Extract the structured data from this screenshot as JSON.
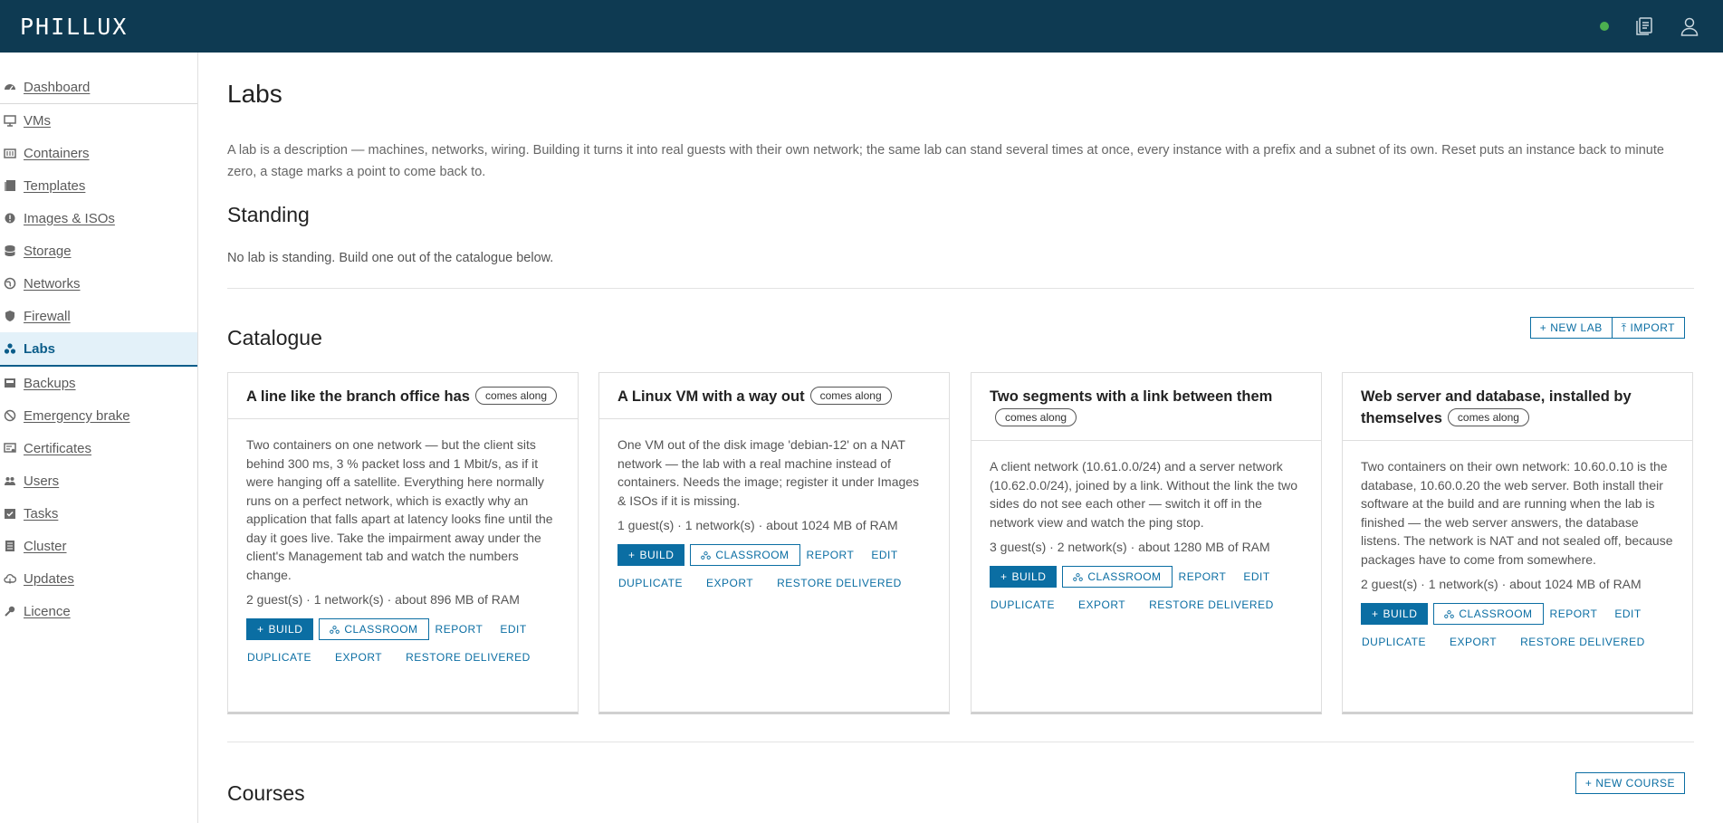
{
  "app": {
    "logo": "PHILLUX",
    "colors": {
      "topbar": "#0e3a52",
      "accent": "#0b6ea3",
      "status": "#4caf50",
      "active_bg": "#e3f1f9"
    }
  },
  "header": {
    "icons": [
      "status-dot",
      "clipboard-icon",
      "user-icon"
    ]
  },
  "sidebar": {
    "items": [
      {
        "label": "Dashboard",
        "icon": "dashboard-icon"
      },
      {
        "label": "VMs",
        "icon": "monitor-icon"
      },
      {
        "label": "Containers",
        "icon": "container-icon"
      },
      {
        "label": "Templates",
        "icon": "template-icon"
      },
      {
        "label": "Images & ISOs",
        "icon": "disc-icon"
      },
      {
        "label": "Storage",
        "icon": "database-icon"
      },
      {
        "label": "Networks",
        "icon": "globe-icon"
      },
      {
        "label": "Firewall",
        "icon": "shield-icon"
      },
      {
        "label": "Labs",
        "icon": "labs-icon",
        "active": true
      },
      {
        "label": "Backups",
        "icon": "backup-icon"
      },
      {
        "label": "Emergency brake",
        "icon": "brake-icon"
      },
      {
        "label": "Certificates",
        "icon": "certificate-icon"
      },
      {
        "label": "Users",
        "icon": "users-icon"
      },
      {
        "label": "Tasks",
        "icon": "tasks-icon"
      },
      {
        "label": "Cluster",
        "icon": "cluster-icon"
      },
      {
        "label": "Updates",
        "icon": "cloud-icon"
      },
      {
        "label": "Licence",
        "icon": "licence-icon"
      }
    ]
  },
  "main": {
    "title": "Labs",
    "intro": "A lab is a description — machines, networks, wiring. Building it turns it into real guests with their own network; the same lab can stand several times at once, every instance with a prefix and a subnet of its own. Reset puts an instance back to minute zero, a stage marks a point to come back to.",
    "standing": {
      "title": "Standing",
      "text": "No lab is standing. Build one out of the catalogue below."
    },
    "catalogue": {
      "title": "Catalogue",
      "new_lab": "NEW LAB",
      "import": "IMPORT",
      "badge": "comes along",
      "actions": {
        "build": "BUILD",
        "classroom": "CLASSROOM",
        "report": "REPORT",
        "edit": "EDIT",
        "duplicate": "DUPLICATE",
        "export": "EXPORT",
        "restore": "RESTORE DELIVERED"
      },
      "cards": [
        {
          "title": "A line like the branch office has",
          "description": "Two containers on one network — but the client sits behind 300 ms, 3 % packet loss and 1 Mbit/s, as if it were hanging off a satellite. Everything here normally runs on a perfect network, which is exactly why an application that falls apart at latency looks fine until the day it goes live. Take the impairment away under the client's Management tab and watch the numbers change.",
          "stats": "2 guest(s) · 1 network(s) · about 896 MB of RAM"
        },
        {
          "title": "A Linux VM with a way out",
          "description": "One VM out of the disk image 'debian-12' on a NAT network — the lab with a real machine instead of containers. Needs the image; register it under Images & ISOs if it is missing.",
          "stats": "1 guest(s) · 1 network(s) · about 1024 MB of RAM"
        },
        {
          "title": "Two segments with a link between them",
          "description": "A client network (10.61.0.0/24) and a server network (10.62.0.0/24), joined by a link. Without the link the two sides do not see each other — switch it off in the network view and watch the ping stop.",
          "stats": "3 guest(s) · 2 network(s) · about 1280 MB of RAM"
        },
        {
          "title": "Web server and database, installed by themselves",
          "description": "Two containers on their own network: 10.60.0.10 is the database, 10.60.0.20 the web server. Both install their software at the build and are running when the lab is finished — the web server answers, the database listens. The network is NAT and not sealed off, because packages have to come from somewhere.",
          "stats": "2 guest(s) · 1 network(s) · about 1024 MB of RAM"
        }
      ]
    },
    "courses": {
      "title": "Courses",
      "new_course": "NEW COURSE"
    }
  }
}
